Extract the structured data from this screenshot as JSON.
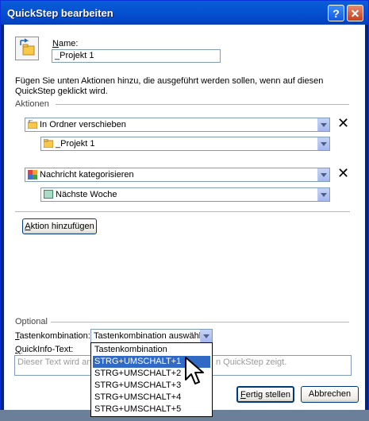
{
  "window": {
    "title": "QuickStep bearbeiten",
    "help_glyph": "?",
    "close_glyph": "✕"
  },
  "name": {
    "label_u": "N",
    "label_rest": "ame:",
    "value": "_Projekt 1"
  },
  "description": "Fügen Sie unten Aktionen hinzu, die ausgeführt werden sollen, wenn auf diesen QuickStep geklickt wird.",
  "actions": {
    "section_label": "Aktionen",
    "items": [
      {
        "action": "In Ordner verschieben",
        "option": "_Projekt 1",
        "icon": "move-folder-icon",
        "option_icon": "folder-icon"
      },
      {
        "action": "Nachricht kategorisieren",
        "option": "Nächste Woche",
        "icon": "categorize-icon",
        "option_icon": "category-color-icon"
      }
    ],
    "delete_glyph": "✕",
    "add_button": {
      "u": "A",
      "rest": "ktion hinzufügen"
    }
  },
  "optional": {
    "section_label": "Optional",
    "shortcut_label_u": "T",
    "shortcut_label_rest": "astenkombination:",
    "shortcut_value": "Tastenkombination auswählen",
    "tooltip_label_u": "Q",
    "tooltip_label_rest": "uickInfo-Text:",
    "tooltip_placeholder_left": "Dieser Text wird ange",
    "tooltip_placeholder_right": "n QuickStep zeigt.",
    "dropdown_options": [
      "Tastenkombination auswählen",
      "STRG+UMSCHALT+1",
      "STRG+UMSCHALT+2",
      "STRG+UMSCHALT+3",
      "STRG+UMSCHALT+4",
      "STRG+UMSCHALT+5"
    ],
    "selected_index": 1
  },
  "footer": {
    "finish_u": "F",
    "finish_rest": "ertig stellen",
    "cancel": "Abbrechen"
  },
  "colors": {
    "titlebar": "#0653d2",
    "selection": "#316ac5",
    "border": "#7f9db9"
  }
}
